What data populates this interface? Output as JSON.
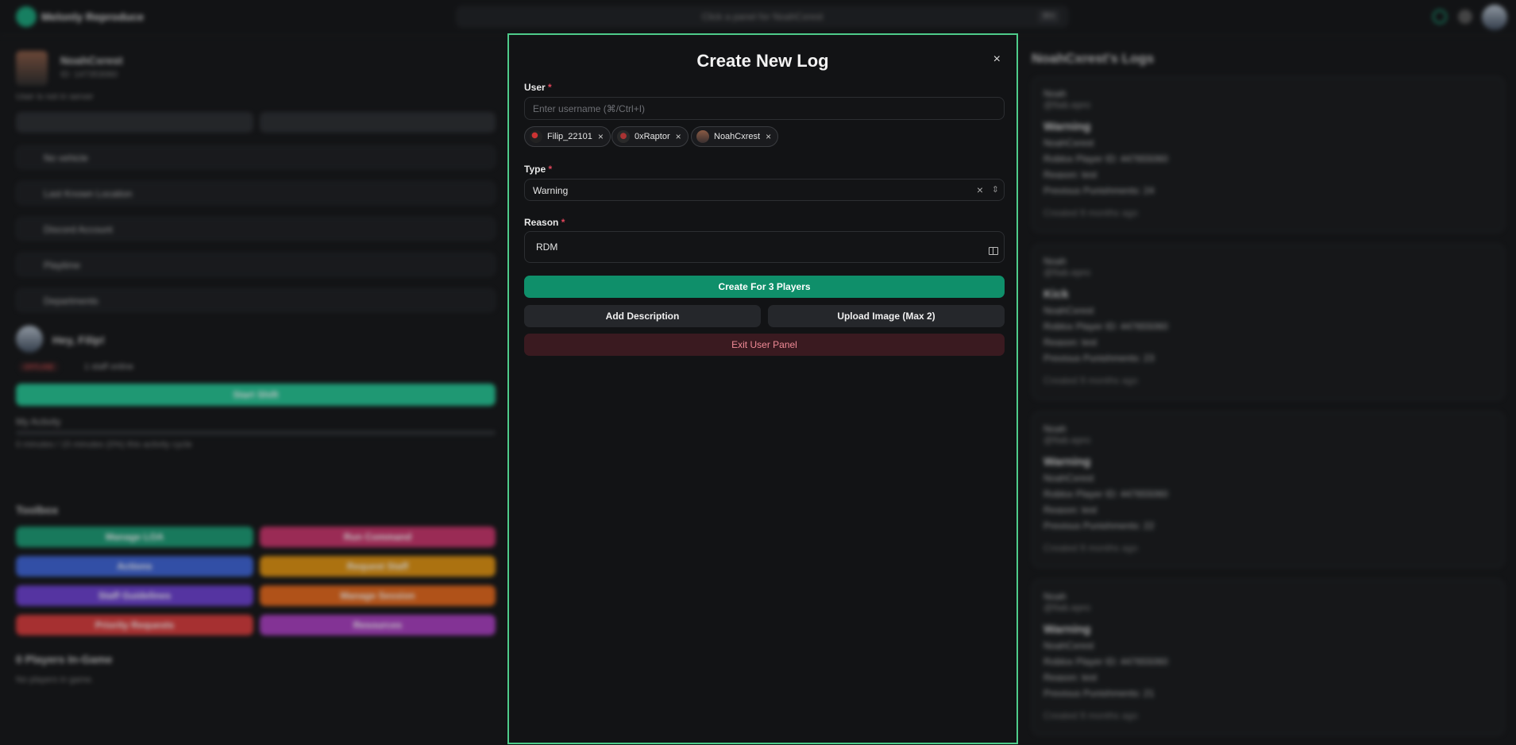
{
  "modal": {
    "title": "Create New Log",
    "close_glyph": "×",
    "user_label": "User",
    "user_placeholder": "Enter username (⌘/Ctrl+I)",
    "required_mark": "*",
    "selected_users": [
      {
        "name": "Filip_22101",
        "remove": "×"
      },
      {
        "name": "0xRaptor",
        "remove": "×"
      },
      {
        "name": "NoahCxrest",
        "remove": "×"
      }
    ],
    "type_label": "Type",
    "type_value": "Warning",
    "type_clear": "×",
    "type_arrows": "⇕",
    "reason_label": "Reason",
    "reason_value": "RDM",
    "create_button": "Create For 3 Players",
    "add_description_button": "Add Description",
    "upload_image_button": "Upload Image (Max 2)",
    "exit_button": "Exit User Panel"
  },
  "background": {
    "brand": "Melonly Reproduce",
    "search_text": "Click a panel for NoahCxrest",
    "search_kbd": "⌘K",
    "profile_name": "NoahCxrest",
    "profile_id": "ID: 147353060",
    "profile_status": "User is not in server",
    "rows": [
      "No vehicle",
      "Last Known Location",
      "Discord Account",
      "Playtime",
      "Departments"
    ],
    "greeting": "Hey, Filip!",
    "status_badge": "OFFLINE",
    "staff_online": "1 staff online",
    "start_shift": "Start Shift",
    "activity_title": "My Activity",
    "activity_text": "0 minutes / 15 minutes (0%) this activity cycle",
    "toolbox_title": "Toolbox",
    "toolbox": [
      {
        "label": "Manage LOA",
        "color": "#1a9b74"
      },
      {
        "label": "Run Command",
        "color": "#c8336a"
      },
      {
        "label": "Actions",
        "color": "#3d63d6"
      },
      {
        "label": "Request Staff",
        "color": "#e0920f"
      },
      {
        "label": "Staff Guidelines",
        "color": "#6b3fd0"
      },
      {
        "label": "Manage Session",
        "color": "#e5671a"
      },
      {
        "label": "Priority Requests",
        "color": "#d83a3a"
      },
      {
        "label": "Resources",
        "color": "#a93ec0"
      }
    ],
    "players_title": "0 Players In-Game",
    "players_text": "No players in game.",
    "logs_title": "NoahCxrest's Logs",
    "logs": [
      {
        "author": "Noah",
        "handle": "@fiab.epro",
        "type": "Warning",
        "user": "NoahCxrest",
        "player_id": "Roblox Player ID: 447655060",
        "reason": "Reason: test",
        "previous": "Previous Punishments: 24",
        "created": "Created 9 months ago"
      },
      {
        "author": "Noah",
        "handle": "@fiab.epro",
        "type": "Kick",
        "user": "NoahCxrest",
        "player_id": "Roblox Player ID: 447655060",
        "reason": "Reason: test",
        "previous": "Previous Punishments: 23",
        "created": "Created 9 months ago"
      },
      {
        "author": "Noah",
        "handle": "@fiab.epro",
        "type": "Warning",
        "user": "NoahCxrest",
        "player_id": "Roblox Player ID: 447655060",
        "reason": "Reason: test",
        "previous": "Previous Punishments: 22",
        "created": "Created 9 months ago"
      },
      {
        "author": "Noah",
        "handle": "@fiab.epro",
        "type": "Warning",
        "user": "NoahCxrest",
        "player_id": "Roblox Player ID: 447655060",
        "reason": "Reason: test",
        "previous": "Previous Punishments: 21",
        "created": "Created 9 months ago"
      }
    ]
  }
}
